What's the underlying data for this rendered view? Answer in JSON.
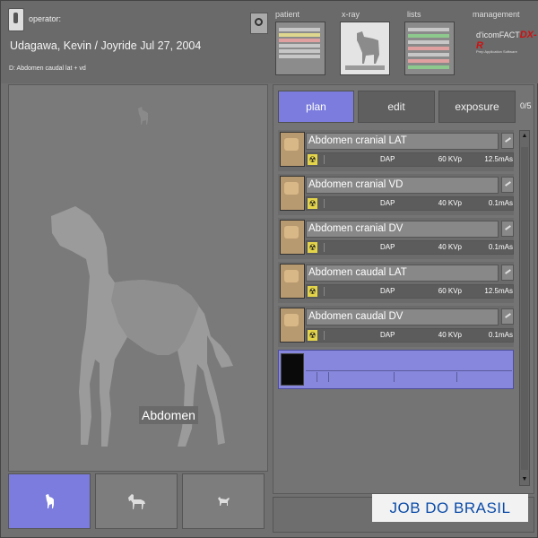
{
  "header": {
    "operator_label": "operator:",
    "patient_line": "Udagawa, Kevin / Joyride  Jul 27, 2004",
    "exam_line": "D: Abdomen caudal lat + vd"
  },
  "nav": {
    "patient": "patient",
    "xray": "x-ray",
    "lists": "lists",
    "management": "management"
  },
  "brand": {
    "logo_prefix": "d'icomFACT",
    "logo_suffix": "DX-R",
    "sub": "Prep Application Software"
  },
  "viewer": {
    "region_label": "Abdomen"
  },
  "species": [
    "dog",
    "horse",
    "cat"
  ],
  "tabs": {
    "plan": "plan",
    "edit": "edit",
    "exposure": "exposure",
    "counter": "0/5"
  },
  "exams": [
    {
      "title": "Abdomen cranial LAT",
      "dap": "DAP",
      "kvp": "60 KVp",
      "mas": "12.5mAs"
    },
    {
      "title": "Abdomen cranial VD",
      "dap": "DAP",
      "kvp": "40 KVp",
      "mas": "0.1mAs"
    },
    {
      "title": "Abdomen cranial DV",
      "dap": "DAP",
      "kvp": "40 KVp",
      "mas": "0.1mAs"
    },
    {
      "title": "Abdomen caudal LAT",
      "dap": "DAP",
      "kvp": "60 KVp",
      "mas": "12.5mAs"
    },
    {
      "title": "Abdomen caudal DV",
      "dap": "DAP",
      "kvp": "40 KVp",
      "mas": "0.1mAs"
    }
  ],
  "watermark": "JOB DO BRASIL",
  "colors": {
    "accent": "#7b7cdd",
    "background": "#707070"
  }
}
